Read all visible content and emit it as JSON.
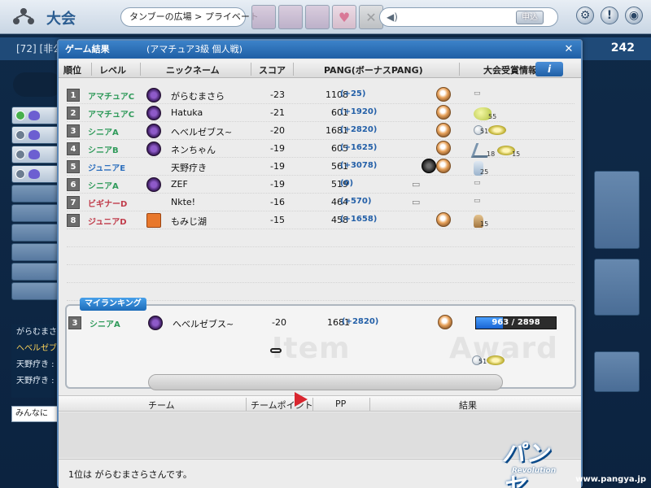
{
  "top_bar": {
    "title": "大会",
    "breadcrumb": "タンブーの広場 > プライベート",
    "apply_label": "申込"
  },
  "lobby": {
    "room_info": "[72] [非公",
    "points": "242",
    "chat": [
      "がらむまさ",
      "へべルゼブ",
      "天野疗き :",
      "天野疗き :"
    ],
    "chat_target": "みんなに"
  },
  "dialog": {
    "title": "ゲーム結果",
    "subtitle": "(アマチュア3級 個人戦)",
    "columns": {
      "rank": "順位",
      "level": "レベル",
      "nickname": "ニックネーム",
      "score": "スコア",
      "pang": "PANG(ボーナスPANG)",
      "award_info": "大会受賞情報"
    },
    "info_button": "i",
    "rows": [
      {
        "rank": "1",
        "level": "アマチュアC",
        "level_color": "green",
        "emblem": "purple",
        "nickname": "がらむまさら",
        "score": "-23",
        "pang": "1108",
        "bonus": "(+25)",
        "dark": false,
        "award": "none"
      },
      {
        "rank": "2",
        "level": "アマチュアC",
        "level_color": "green",
        "emblem": "purple",
        "nickname": "Hatuka",
        "score": "-21",
        "pang": "601",
        "bonus": "(+1920)",
        "dark": false,
        "award": "glove",
        "award_count": "55"
      },
      {
        "rank": "3",
        "level": "シニアA",
        "level_color": "green",
        "emblem": "purple",
        "nickname": "へべルゼブス~",
        "score": "-20",
        "pang": "1681",
        "bonus": "(+2820)",
        "dark": false,
        "award": "ring",
        "award_count": "51"
      },
      {
        "rank": "4",
        "level": "シニアB",
        "level_color": "green",
        "emblem": "purple",
        "nickname": "ネンちゃん",
        "score": "-19",
        "pang": "605",
        "bonus": "(+1625)",
        "dark": false,
        "award": "club_ring",
        "award_count": "18",
        "award_count2": "15"
      },
      {
        "rank": "5",
        "level": "ジュニアE",
        "level_color": "blue",
        "emblem": "none",
        "nickname": "天野疗き",
        "score": "-19",
        "pang": "561",
        "bonus": "(+3078)",
        "dark": true,
        "award": "bag",
        "award_count": "25"
      },
      {
        "rank": "6",
        "level": "シニアA",
        "level_color": "green",
        "emblem": "purple",
        "nickname": "ZEF",
        "score": "-19",
        "pang": "519",
        "bonus": "(0)",
        "dark": false,
        "award": "dash",
        "no_mascot": true
      },
      {
        "rank": "7",
        "level": "ビギナーD",
        "level_color": "red",
        "emblem": "none",
        "nickname": "Nkte!",
        "score": "-16",
        "pang": "464",
        "bonus": "(+570)",
        "dark": false,
        "award": "dash",
        "no_mascot": true
      },
      {
        "rank": "8",
        "level": "ジュニアD",
        "level_color": "red",
        "emblem": "cat",
        "nickname": "もみじ湖",
        "score": "-15",
        "pang": "458",
        "bonus": "(+1658)",
        "dark": false,
        "award": "figure",
        "award_count": "15"
      }
    ],
    "my_ranking": {
      "tab": "マイランキング",
      "rank": "3",
      "level": "シニアA",
      "nickname": "へべルゼブス~",
      "score": "-20",
      "pang": "1681",
      "bonus": "(+2820)",
      "exp_text": "963 / 2898",
      "exp_fraction": 0.332,
      "item_label": "Item",
      "award_label": "Award",
      "award_count": "51"
    },
    "team_columns": {
      "team": "チーム",
      "team_points": "チームポイント",
      "pp": "PP",
      "result": "結果"
    },
    "footer": "1位は がらむまさらさんです。"
  },
  "branding": {
    "logo_text": "パンヤ",
    "logo_sub": "Revolution",
    "url": "www.pangya.jp"
  }
}
